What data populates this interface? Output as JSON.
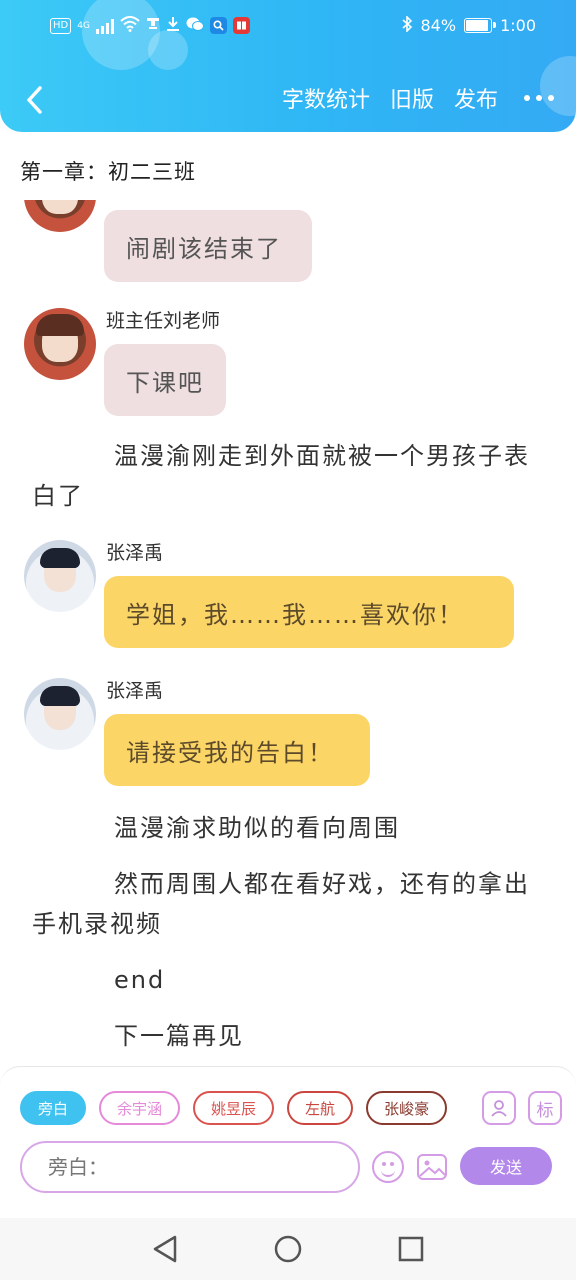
{
  "status_bar": {
    "hd": "HD",
    "network": "4G",
    "battery_text": "84%",
    "battery_level": 0.84,
    "time": "1:00"
  },
  "nav": {
    "back_icon": "chevron-left-icon",
    "word_count": "字数统计",
    "old_version": "旧版",
    "publish": "发布",
    "more_icon": "more-dots-icon"
  },
  "chapter_title": "第一章：初二三班",
  "messages": [
    {
      "type": "chat",
      "speaker": "",
      "avatar": "teacher",
      "text": "闹剧该结束了",
      "bubble_color": "#efdfe1"
    },
    {
      "type": "chat",
      "speaker": "班主任刘老师",
      "avatar": "teacher",
      "text": "下课吧",
      "bubble_color": "#efdfe1"
    },
    {
      "type": "narration",
      "text": "温漫渝刚走到外面就被一个男孩子表白了"
    },
    {
      "type": "chat",
      "speaker": "张泽禹",
      "avatar": "boy",
      "text": "学姐，我……我……喜欢你！",
      "bubble_color": "#fbd667"
    },
    {
      "type": "chat",
      "speaker": "张泽禹",
      "avatar": "boy",
      "text": "请接受我的告白！",
      "bubble_color": "#fbd667"
    },
    {
      "type": "narration",
      "text": "温漫渝求助似的看向周围"
    },
    {
      "type": "narration",
      "text": "然而周围人都在看好戏，还有的拿出手机录视频"
    },
    {
      "type": "narration",
      "text": "end"
    },
    {
      "type": "narration",
      "text": "下一篇再见"
    }
  ],
  "roles": [
    {
      "label": "旁白",
      "active": true,
      "color": "#3fc2f0"
    },
    {
      "label": "余宇涵",
      "active": false,
      "color": "#e48ad8"
    },
    {
      "label": "姚昱辰",
      "active": false,
      "color": "#d9534f"
    },
    {
      "label": "左航",
      "active": false,
      "color": "#c9473f"
    },
    {
      "label": "张峻豪",
      "active": false,
      "color": "#8a3a2e"
    }
  ],
  "tools": {
    "add_role_icon": "person-icon",
    "tag_label": "标"
  },
  "input": {
    "placeholder": "旁白：",
    "send_label": "发送",
    "emoji_icon": "emoji-icon",
    "image_icon": "image-icon"
  },
  "system_nav": {
    "back_icon": "triangle-back-icon",
    "home_icon": "circle-home-icon",
    "recents_icon": "square-recents-icon"
  },
  "colors": {
    "header": "#2fb6f5",
    "accent_purple": "#b288ea",
    "pink_bubble": "#efdfe1",
    "yellow_bubble": "#fbd667"
  }
}
